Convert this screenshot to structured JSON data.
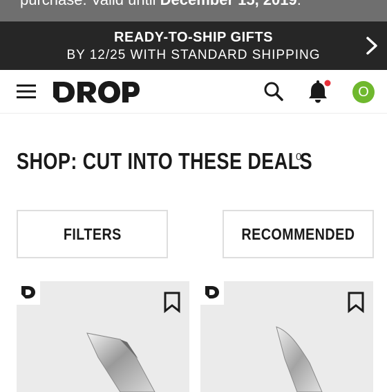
{
  "promo_top": {
    "text_before": "purchase. Valid until ",
    "text_bold": "December 15, 2019",
    "text_after": "."
  },
  "shipping_banner": {
    "title": "READY-TO-SHIP GIFTS",
    "subtitle": "BY 12/25 WITH STANDARD SHIPPING",
    "arrow_icon": "chevron-right-icon"
  },
  "navbar": {
    "logo": "DROP",
    "icons": [
      "menu-icon",
      "search-icon",
      "bell-icon"
    ],
    "notification_dot_color": "#e8303a",
    "avatar_initial": "O",
    "avatar_color": "#6fb82e"
  },
  "main": {
    "title": "SHOP: CUT INTO THESE DEALS",
    "title_sup": "0",
    "filters_label": "FILTERS",
    "sort_label": "RECOMMENDED"
  },
  "products": [
    {
      "badge_icon": "drop-logo-icon",
      "bookmark_icon": "bookmark-icon"
    },
    {
      "badge_icon": "drop-logo-icon",
      "bookmark_icon": "bookmark-icon"
    }
  ]
}
